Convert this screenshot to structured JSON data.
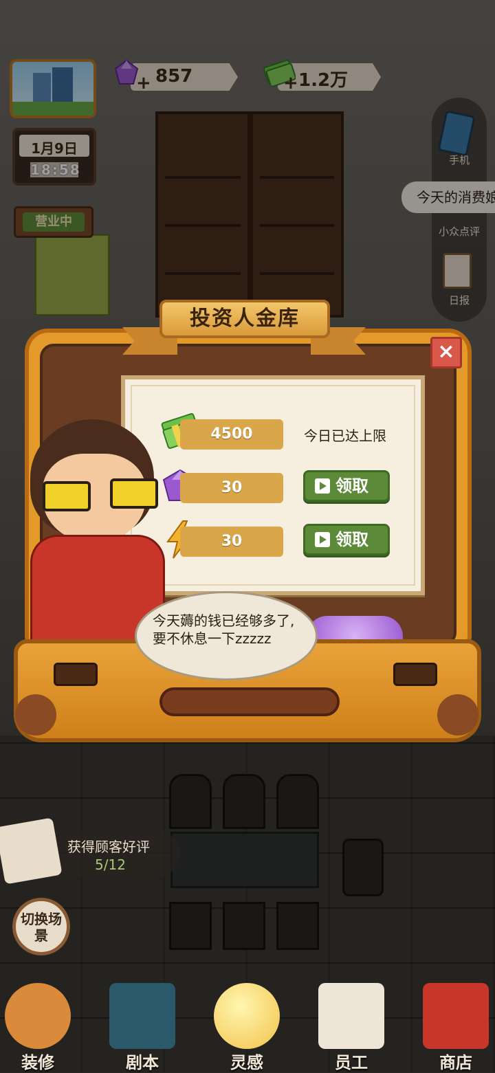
{
  "top_bar": {
    "gems": "857",
    "money": "1.2万",
    "plus": "+"
  },
  "calendar": {
    "date": "1月9日",
    "time": "18:58"
  },
  "open_sign": "营业中",
  "side_menu": {
    "phone": "手机",
    "review": "小众点评",
    "daily": "日报",
    "comment_bubble": "今天的消费娘"
  },
  "dialog": {
    "title": "投资人金库",
    "close": "×",
    "rows": [
      {
        "icon": "money-icon",
        "value": "4500",
        "status": "今日已达上限"
      },
      {
        "icon": "gem-icon",
        "value": "30",
        "button": "领取"
      },
      {
        "icon": "energy-icon",
        "value": "30",
        "button": "领取"
      }
    ],
    "speech": "今天薅的钱已经够多了,要不休息一下zzzzz"
  },
  "task": {
    "label": "获得顾客好评",
    "progress": "5/12"
  },
  "switch_scene": "切换场景",
  "nav": [
    {
      "label": "装修",
      "icon": "house-icon"
    },
    {
      "label": "剧本",
      "icon": "book-icon"
    },
    {
      "label": "灵感",
      "icon": "lightbulb-icon"
    },
    {
      "label": "员工",
      "icon": "badge-icon"
    },
    {
      "label": "商店",
      "icon": "shop-icon"
    }
  ],
  "colors": {
    "accent": "#e39a2a",
    "claim_green": "#5c8a38",
    "close_red": "#d9584a",
    "gem_purple": "#9b59d0"
  }
}
